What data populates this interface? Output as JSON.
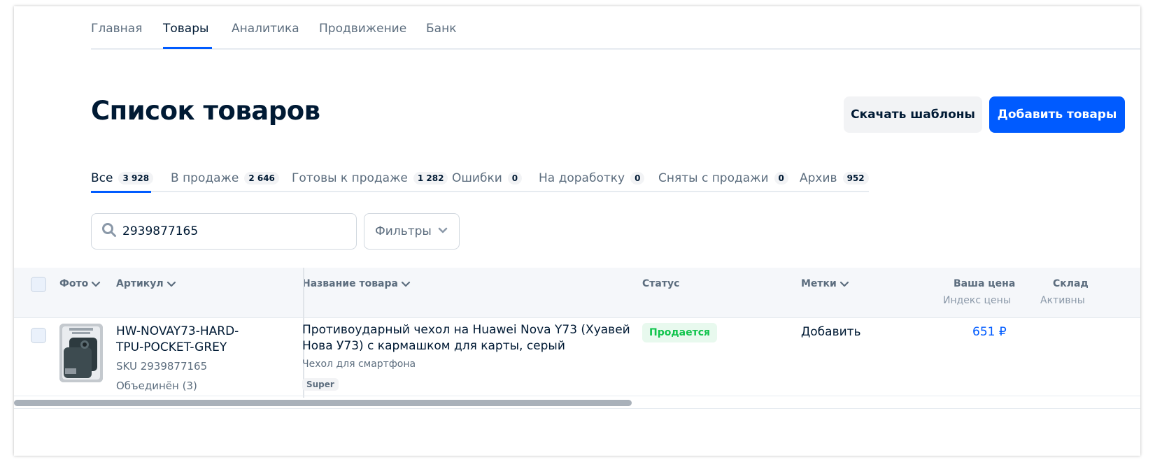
{
  "nav": {
    "items": [
      {
        "label": "Главная"
      },
      {
        "label": "Товары"
      },
      {
        "label": "Аналитика"
      },
      {
        "label": "Продвижение"
      },
      {
        "label": "Банк"
      }
    ],
    "active": "Товары"
  },
  "page": {
    "title": "Список товаров",
    "download_templates_label": "Скачать шаблоны",
    "add_products_label": "Добавить товары"
  },
  "status_tabs": [
    {
      "label": "Все",
      "count": "3 928"
    },
    {
      "label": "В продаже",
      "count": "2 646"
    },
    {
      "label": "Готовы к продаже",
      "count": "1 282"
    },
    {
      "label": "Ошибки",
      "count": "0"
    },
    {
      "label": "На доработку",
      "count": "0"
    },
    {
      "label": "Сняты с продажи",
      "count": "0"
    },
    {
      "label": "Архив",
      "count": "952"
    }
  ],
  "search": {
    "value": "2939877165",
    "icon": "search-icon"
  },
  "filters": {
    "label": "Фильтры",
    "icon": "chevron-down-icon"
  },
  "table": {
    "headers": {
      "photo": "Фото",
      "article": "Артикул",
      "name": "Название товара",
      "status": "Статус",
      "tags": "Метки",
      "price": "Ваша цена",
      "price_sub": "Индекс цены",
      "stock": "Склад",
      "stock_sub": "Активны"
    },
    "rows": [
      {
        "article_line1": "HW-NOVAY73-HARD-",
        "article_line2": "TPU-POCKET-GREY",
        "sku": "SKU 2939877165",
        "combined": "Объединён (3)",
        "name": "Противоударный чехол на Huawei Nova Y73 (Хуавей Нова У73) с кармашком для карты, серый",
        "category": "Чехол для смартфона",
        "tag": "Super",
        "status": "Продается",
        "tags_action": "Добавить",
        "price": "651 ₽"
      }
    ]
  },
  "colors": {
    "accent": "#005bff",
    "text": "#001a34",
    "muted": "#5c6d7e",
    "success": "#10c44c",
    "header_bg": "#f5f7fa"
  }
}
